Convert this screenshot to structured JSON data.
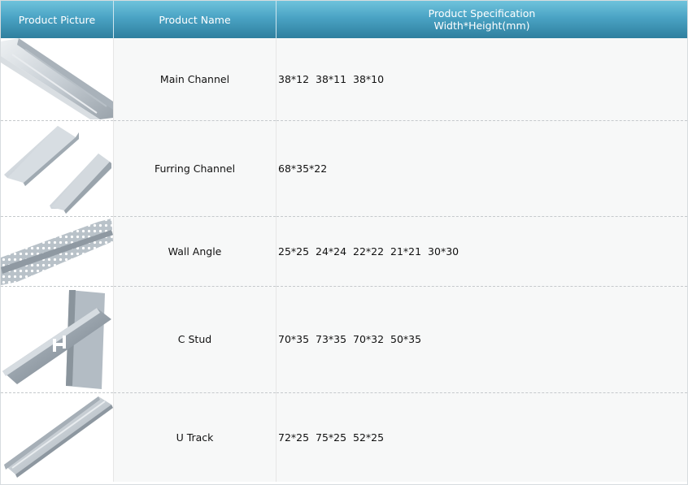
{
  "table": {
    "headers": {
      "picture": "Product Picture",
      "name": "Product Name",
      "spec_line1": "Product Specification",
      "spec_line2": "Width*Height(mm)"
    },
    "rows": [
      {
        "name": "Main Channel",
        "spec": "38*12  38*11  38*10",
        "icon": "main-channel-photo"
      },
      {
        "name": "Furring Channel",
        "spec": "68*35*22",
        "icon": "furring-channel-photo"
      },
      {
        "name": "Wall Angle",
        "spec": "25*25  24*24  22*22  21*21  30*30",
        "icon": "wall-angle-photo"
      },
      {
        "name": "C Stud",
        "spec": "70*35  73*35  70*32  50*35",
        "icon": "c-stud-photo"
      },
      {
        "name": "U Track",
        "spec": "72*25  75*25  52*25",
        "icon": "u-track-photo"
      }
    ]
  },
  "colors": {
    "header_top": "#6fc3dc",
    "header_bottom": "#2f7f9e",
    "row_bg": "#f7f8f8",
    "metal_light": "#e4e8ec",
    "metal_dark": "#8a949c"
  }
}
